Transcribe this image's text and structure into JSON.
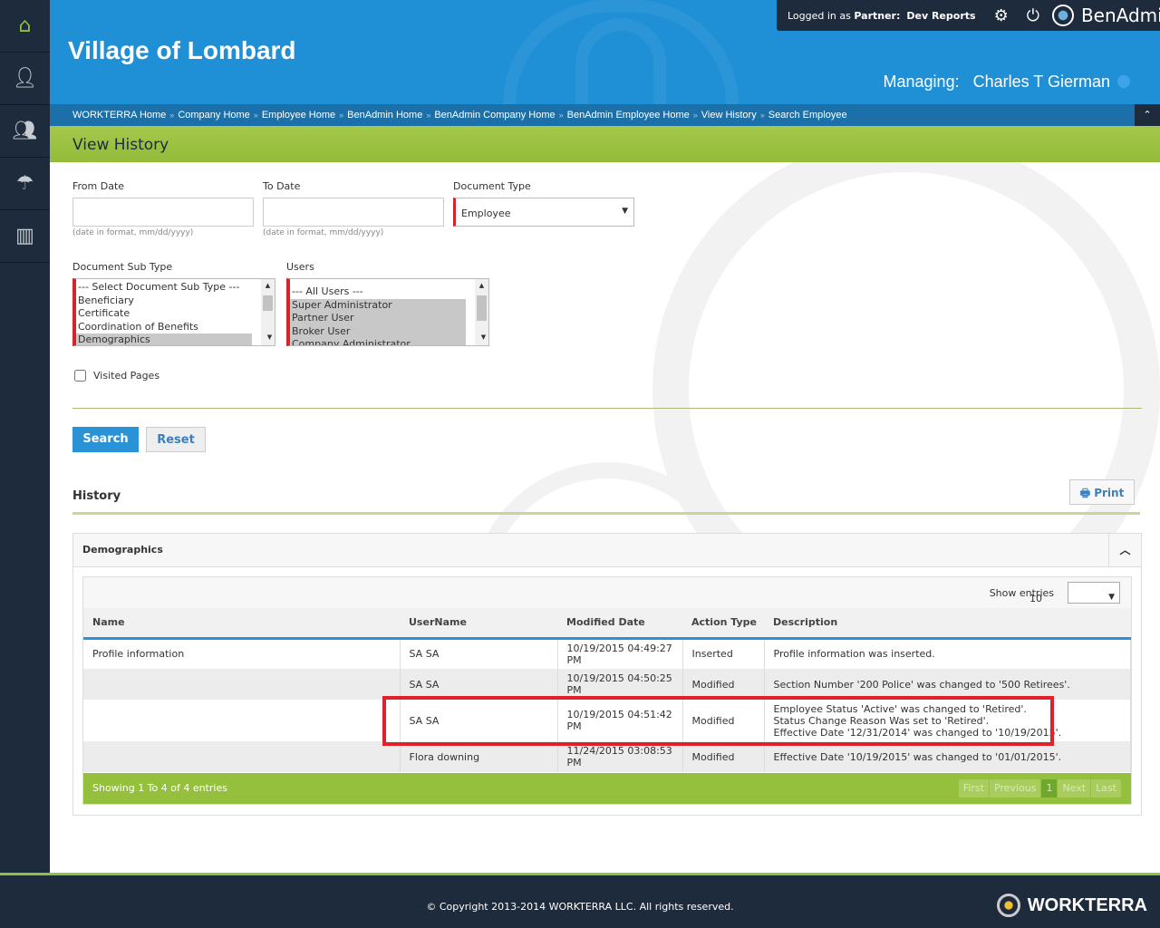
{
  "sidebar": {
    "items": [
      "home-icon",
      "user-icon",
      "users-icon",
      "benefits-icon",
      "reports-icon"
    ]
  },
  "header": {
    "title": "Village of Lombard",
    "login_prefix": "Logged in as",
    "login_role": "Partner:",
    "login_name": "Dev Reports",
    "brand": "BenAdmin",
    "managing_label": "Managing:",
    "managing_name": "Charles T Gierman"
  },
  "breadcrumbs": [
    "WORKTERRA Home",
    "Company Home",
    "Employee Home",
    "BenAdmin Home",
    "BenAdmin Company Home",
    "BenAdmin Employee Home",
    "View History",
    "Search Employee"
  ],
  "page_title": "View History",
  "form": {
    "from_date_label": "From Date",
    "to_date_label": "To Date",
    "date_hint": "(date in format, mm/dd/yyyy)",
    "from_date": "",
    "to_date": "",
    "doc_type_label": "Document Type",
    "doc_type_value": "Employee",
    "doc_subtype_label": "Document Sub Type",
    "doc_subtypes": [
      "--- Select Document Sub Type ---",
      "Beneficiary",
      "Certificate",
      "Coordination of Benefits",
      "Demographics"
    ],
    "users_label": "Users",
    "users": [
      "--- All Users ---",
      "Super Administrator",
      "Partner User",
      "Broker User",
      "Company Administrator"
    ],
    "visited_pages_label": "Visited Pages",
    "search_label": "Search",
    "reset_label": "Reset"
  },
  "history": {
    "title": "History",
    "print_label": "Print",
    "panel_title": "Demographics",
    "show_entries_label": "Show entries",
    "show_entries_value": "10",
    "columns": [
      "Name",
      "UserName",
      "Modified Date",
      "Action Type",
      "Description"
    ],
    "rows": [
      {
        "name": "Profile information",
        "user": "SA SA",
        "date": "10/19/2015 04:49:27 PM",
        "action": "Inserted",
        "desc": [
          "Profile information was inserted."
        ]
      },
      {
        "name": "",
        "user": "SA SA",
        "date": "10/19/2015 04:50:25 PM",
        "action": "Modified",
        "desc": [
          "Section Number '200 Police' was changed to '500 Retirees'."
        ]
      },
      {
        "name": "",
        "user": "SA SA",
        "date": "10/19/2015 04:51:42 PM",
        "action": "Modified",
        "desc": [
          "Employee Status 'Active' was changed to 'Retired'.",
          "Status Change Reason Was set to 'Retired'.",
          "Effective Date '12/31/2014' was changed to '10/19/2015'."
        ]
      },
      {
        "name": "",
        "user": "Flora downing",
        "date": "11/24/2015 03:08:53 PM",
        "action": "Modified",
        "desc": [
          "Effective Date '10/19/2015' was changed to '01/01/2015'."
        ]
      }
    ],
    "footer_text": "Showing 1 To 4 of 4 entries",
    "pager": [
      "First",
      "Previous",
      "1",
      "Next",
      "Last"
    ]
  },
  "footer": {
    "copyright": "© Copyright 2013-2014 WORKTERRA LLC. All rights reserved.",
    "logo": "WORKTERRA"
  }
}
